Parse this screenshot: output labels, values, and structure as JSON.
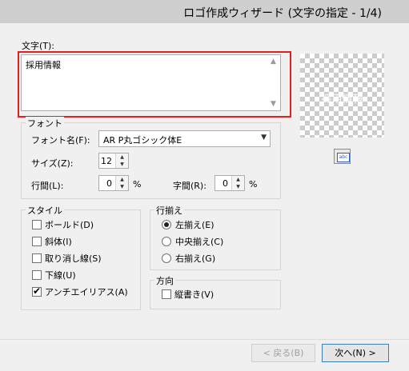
{
  "window": {
    "title": "ロゴ作成ウィザード (文字の指定 - 1/4)"
  },
  "text_section": {
    "label": "文字(T):",
    "value": "採用情報"
  },
  "font_group": {
    "label": "フォント",
    "font_name_label": "フォント名(F):",
    "font_name_value": "AR P丸ゴシック体E",
    "size_label": "サイズ(Z):",
    "size_value": "12",
    "line_spacing_label": "行間(L):",
    "line_spacing_value": "0",
    "line_spacing_unit": "%",
    "char_spacing_label": "字間(R):",
    "char_spacing_value": "0",
    "char_spacing_unit": "%"
  },
  "style_group": {
    "label": "スタイル",
    "items": [
      {
        "label": "ボールド(D)",
        "checked": false
      },
      {
        "label": "斜体(I)",
        "checked": false
      },
      {
        "label": "取り消し線(S)",
        "checked": false
      },
      {
        "label": "下線(U)",
        "checked": false
      },
      {
        "label": "アンチエイリアス(A)",
        "checked": true
      }
    ]
  },
  "align_group": {
    "label": "行揃え",
    "items": [
      {
        "label": "左揃え(E)",
        "selected": true
      },
      {
        "label": "中央揃え(C)",
        "selected": false
      },
      {
        "label": "右揃え(G)",
        "selected": false
      }
    ]
  },
  "direction_group": {
    "label": "方向",
    "vertical_label": "縦書き(V)",
    "vertical_checked": false
  },
  "preview": {
    "text": "採用情報",
    "button_icon": "abc-icon",
    "button_text": "abc"
  },
  "buttons": {
    "back": "< 戻る(B)",
    "next": "次へ(N) >"
  }
}
